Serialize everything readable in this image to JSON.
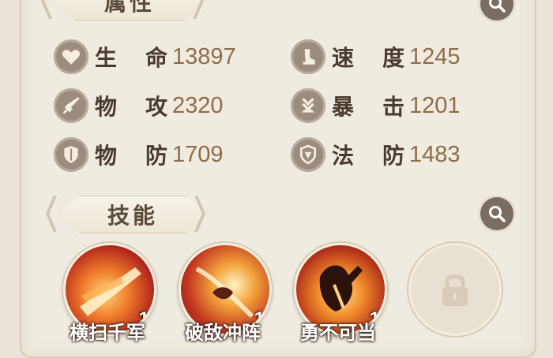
{
  "attributes": {
    "title": "属性",
    "search_icon": "magnifier-icon",
    "stats": [
      {
        "icon": "heart-icon",
        "label_chars": [
          "生",
          "命"
        ],
        "value": "13897"
      },
      {
        "icon": "boot-icon",
        "label_chars": [
          "速",
          "度"
        ],
        "value": "1245"
      },
      {
        "icon": "sword-icon",
        "label_chars": [
          "物",
          "攻"
        ],
        "value": "2320"
      },
      {
        "icon": "arrow-down-icon",
        "label_chars": [
          "暴",
          "击"
        ],
        "value": "1201"
      },
      {
        "icon": "shield-icon",
        "label_chars": [
          "物",
          "防"
        ],
        "value": "1709"
      },
      {
        "icon": "magic-shield-icon",
        "label_chars": [
          "法",
          "防"
        ],
        "value": "1483"
      }
    ]
  },
  "skills": {
    "title": "技能",
    "search_icon": "magnifier-icon",
    "items": [
      {
        "name": "横扫千军",
        "level": "1",
        "icon": "blade-sweep-icon"
      },
      {
        "name": "破敌冲阵",
        "level": "1",
        "icon": "charge-icon"
      },
      {
        "name": "勇不可当",
        "level": "1",
        "icon": "warrior-icon"
      },
      {
        "name": "",
        "level": "",
        "icon": "lock-icon",
        "locked": true
      }
    ]
  },
  "colors": {
    "panel_bg": "#efebe0",
    "label_text": "#4a3b30",
    "value_text": "#8e6d46",
    "icon_bg": "#9c8c7f"
  }
}
